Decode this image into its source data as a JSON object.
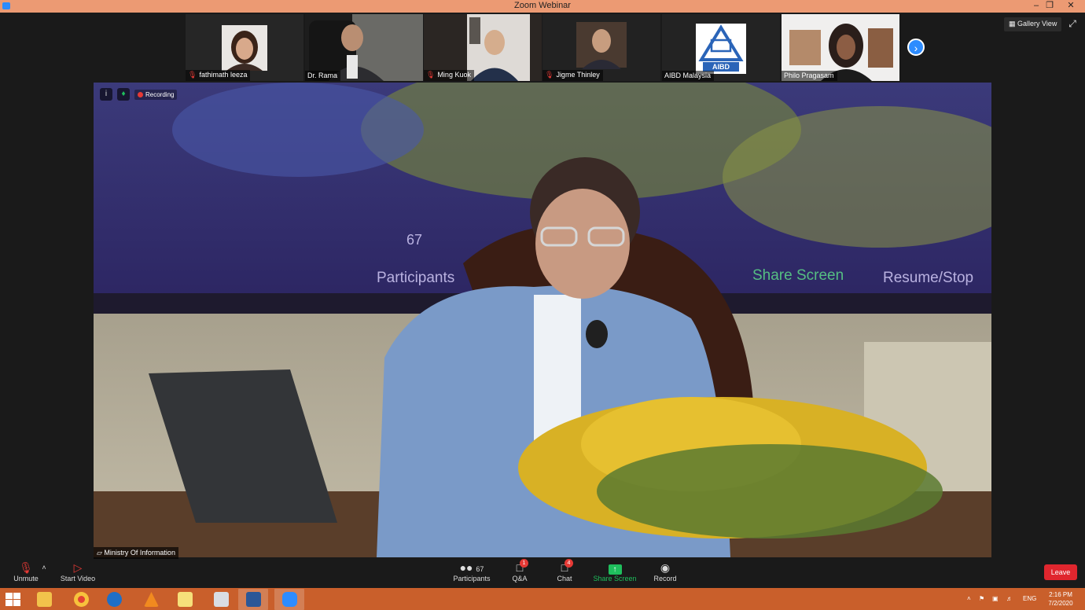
{
  "window": {
    "title": "Zoom Webinar",
    "controls": [
      "minimize",
      "restore",
      "close"
    ]
  },
  "gallery": {
    "view_label": "Gallery View",
    "participants": [
      {
        "name": "fathimath leeza",
        "muted": true
      },
      {
        "name": "Dr. Rama",
        "muted": false
      },
      {
        "name": "Ming Kuok",
        "muted": true
      },
      {
        "name": "Jigme Thinley",
        "muted": true
      },
      {
        "name": "AIBD Malaysia",
        "muted": false,
        "logo_text": "AIBD"
      },
      {
        "name": "Philo Pragasam",
        "muted": false
      }
    ]
  },
  "video": {
    "recording_label": "Recording",
    "speaker_name": "Ministry Of Information",
    "screen_text": {
      "participants_count": "67",
      "participants_label": "Participants",
      "share_label": "Share Screen",
      "resume_label": "Resume/Stop"
    }
  },
  "toolbar": {
    "unmute_label": "Unmute",
    "start_video_label": "Start Video",
    "participants_label": "Participants",
    "participants_count": "67",
    "qa_label": "Q&A",
    "qa_badge": "1",
    "chat_label": "Chat",
    "chat_badge": "4",
    "share_label": "Share Screen",
    "record_label": "Record",
    "leave_label": "Leave"
  },
  "taskbar": {
    "apps": [
      "file-explorer",
      "chrome",
      "outlook",
      "vlc",
      "sticky-notes",
      "calculator",
      "word",
      "zoom"
    ],
    "language": "ENG",
    "time": "2:16 PM",
    "date": "7/2/2020"
  },
  "colors": {
    "title_bar": "#ec9a73",
    "taskbar": "#c95f2b",
    "zoom_blue": "#2d8cff",
    "share_green": "#1fbf5d",
    "leave_red": "#e0262e"
  }
}
